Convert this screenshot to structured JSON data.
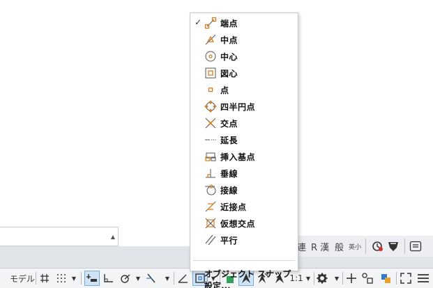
{
  "menu": {
    "check_glyph": "✓",
    "items": [
      "端点",
      "中点",
      "中心",
      "図心",
      "点",
      "四半円点",
      "交点",
      "延長",
      "挿入基点",
      "垂線",
      "接線",
      "近接点",
      "仮想交点",
      "平行"
    ],
    "checked_item": "端点",
    "settings_label": "オブジェクト スナップ設定..."
  },
  "tray": {
    "items": [
      "連",
      "R 漢",
      "般",
      "英小"
    ]
  },
  "status_bar": {
    "model_label": "モデル",
    "scale_label": "1:1"
  },
  "colors": {
    "snap_marker": "#d67a1c",
    "active_button_bg": "#cfe3f7",
    "active_button_border": "#7aaad8"
  }
}
